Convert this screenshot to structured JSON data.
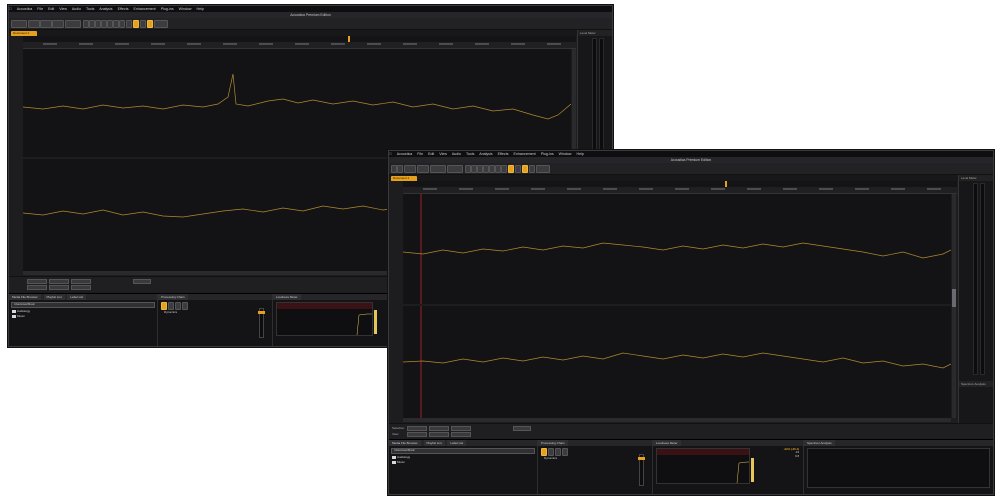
{
  "window_back": {
    "menu": [
      "Acoustica",
      "File",
      "Edit",
      "View",
      "Audio",
      "Tools",
      "Analysis",
      "Effects",
      "Enhancement",
      "Plug-ins",
      "Window",
      "Help"
    ],
    "window_title": "Acoustica Premium Edition",
    "doc_tab": "Document 1",
    "level_meter_label": "Level Meter",
    "tabs": [
      "Media File Browser",
      "Playlist List",
      "Label List"
    ],
    "path": "/Users/user/Music",
    "folders": [
      "Audiology",
      "Music"
    ],
    "processing_chain_label": "Processing Chain",
    "chain_item": "Dynamics",
    "loudness_meter_label": "Loudness Meter"
  },
  "window_front": {
    "menu": [
      "Acoustica",
      "File",
      "Edit",
      "View",
      "Audio",
      "Tools",
      "Analysis",
      "Effects",
      "Enhancement",
      "Plug-ins",
      "Window",
      "Help"
    ],
    "window_title": "Acoustica Premium Edition",
    "doc_tab": "Document 1",
    "level_meter_label": "Level Meter",
    "spectrum_label": "Spectrum Analysis",
    "selection_labels": [
      "Selection",
      "View"
    ],
    "selection_cols": [
      "Start",
      "To",
      "Duration"
    ],
    "tabs": [
      "Media File Browser",
      "Playlist List",
      "Label List"
    ],
    "path": "/Users/user/Music",
    "folders": [
      "Audiology",
      "Music"
    ],
    "processing_chain_label": "Processing Chain",
    "chain_item": "Dynamics",
    "loudness_meter_label": "Loudness Meter",
    "spectrum_pane_label": "Spectrum Analysis",
    "loudness_readouts": [
      "-22.9 (-20.1)",
      "-19",
      "9.8"
    ]
  },
  "colors": {
    "accent": "#e6a11c",
    "waveform": "#b08a2e",
    "background": "#1d1d20",
    "playhead": "#c0272d"
  },
  "icons": [
    "folder-icon",
    "close-icon",
    "play-icon",
    "stop-icon",
    "record-icon"
  ]
}
